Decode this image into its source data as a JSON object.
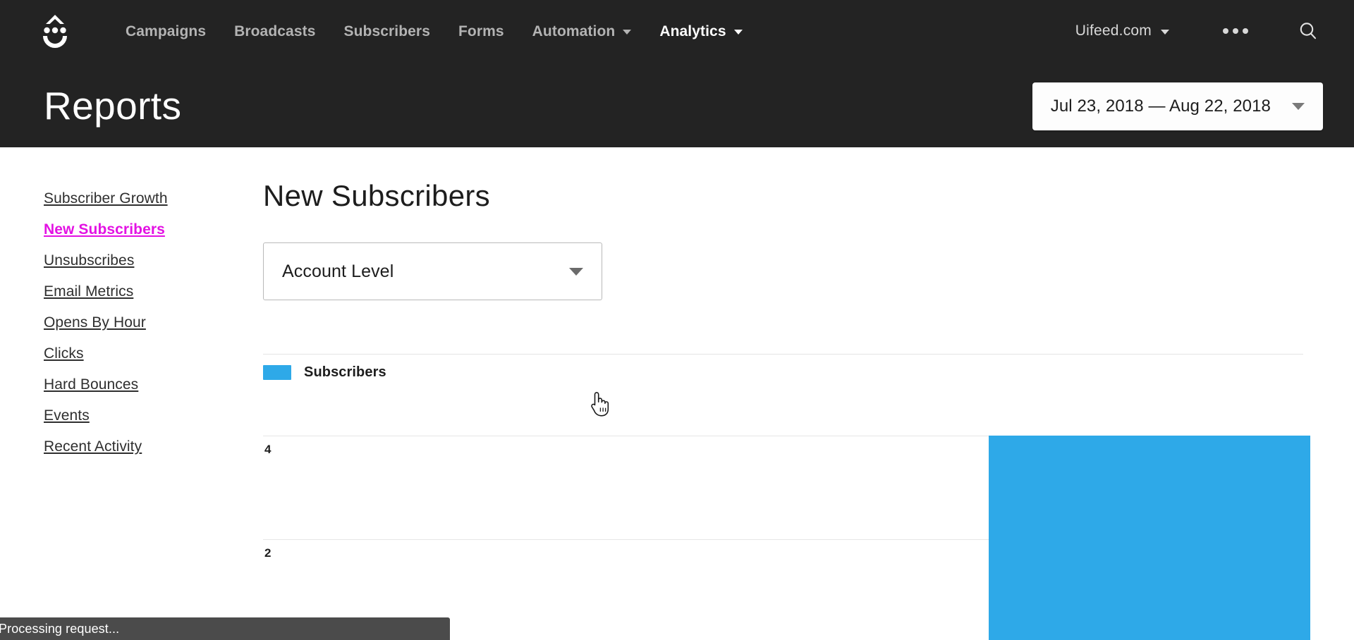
{
  "navbar": {
    "logo_name": "convertkit-smiley-logo",
    "links": [
      {
        "label": "Campaigns",
        "active": false,
        "has_caret": false
      },
      {
        "label": "Broadcasts",
        "active": false,
        "has_caret": false
      },
      {
        "label": "Subscribers",
        "active": false,
        "has_caret": false
      },
      {
        "label": "Forms",
        "active": false,
        "has_caret": false
      },
      {
        "label": "Automation",
        "active": false,
        "has_caret": true
      },
      {
        "label": "Analytics",
        "active": true,
        "has_caret": true
      }
    ],
    "account": "Uifeed.com",
    "overflow_icon": "more-dots-icon",
    "search_icon": "search-icon",
    "background": "#232323",
    "inactive_link_color": "#b3b3b3",
    "active_link_color": "#ffffff"
  },
  "header": {
    "title": "Reports",
    "date_range": "Jul 23, 2018 — Aug 22, 2018"
  },
  "sidebar": {
    "items": [
      {
        "label": "Subscriber Growth",
        "active": false
      },
      {
        "label": "New Subscribers",
        "active": true
      },
      {
        "label": "Unsubscribes",
        "active": false
      },
      {
        "label": "Email Metrics",
        "active": false
      },
      {
        "label": "Opens By Hour",
        "active": false
      },
      {
        "label": "Clicks",
        "active": false
      },
      {
        "label": "Hard Bounces",
        "active": false
      },
      {
        "label": "Events",
        "active": false
      },
      {
        "label": "Recent Activity",
        "active": false
      }
    ],
    "active_color": "#e312e3"
  },
  "main": {
    "section_title": "New Subscribers",
    "level_select": {
      "value": "Account Level",
      "options": [
        "Account Level"
      ]
    }
  },
  "chart_data": {
    "type": "bar",
    "title": "New Subscribers",
    "xlabel": "",
    "ylabel": "",
    "legend": [
      {
        "name": "Subscribers",
        "color": "#2ea9e8"
      }
    ],
    "legend_position": "top-left",
    "grid": true,
    "y_ticks": [
      "4",
      "2"
    ],
    "y_tick_values": [
      4,
      2
    ],
    "ylim": [
      0,
      4.8
    ],
    "categories": [
      ""
    ],
    "series": [
      {
        "name": "Subscribers",
        "values": [
          4
        ]
      }
    ],
    "bars": [
      {
        "category": "",
        "value": 4,
        "color": "#2ea9e8"
      }
    ],
    "note": "Single blue bar reaching the value 4 gridline; chart is clipped by the viewport bottom."
  },
  "status": {
    "message": "Processing request...",
    "background": "#4b4b4b"
  },
  "cursor": {
    "icon": "pointing-hand-cursor"
  }
}
